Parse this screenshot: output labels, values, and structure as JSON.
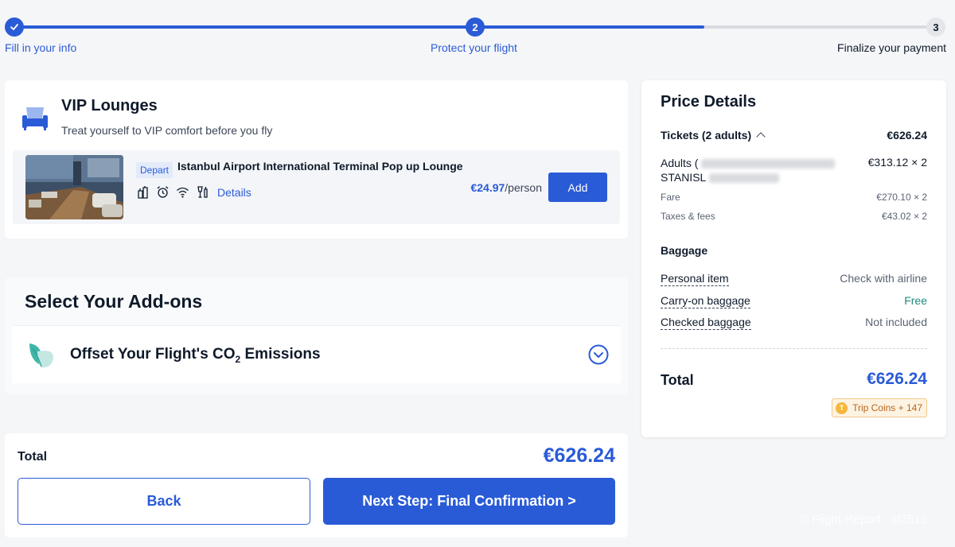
{
  "stepper": {
    "steps": [
      {
        "number": "",
        "label": "Fill in your info",
        "state": "done"
      },
      {
        "number": "2",
        "label": "Protect your flight",
        "state": "active"
      },
      {
        "number": "3",
        "label": "Finalize your payment",
        "state": "todo"
      }
    ],
    "progress_fraction": 0.75
  },
  "vip": {
    "title": "VIP Lounges",
    "subtitle": "Treat yourself to VIP comfort before you fly",
    "lounge": {
      "tag": "Depart",
      "name": "Istanbul Airport International Terminal Pop up Lounge",
      "amenities": [
        "food-icon",
        "alarm-icon",
        "wifi-icon",
        "drinks-icon"
      ],
      "details_label": "Details",
      "price": "€24.97",
      "price_unit": "/person",
      "add_label": "Add"
    }
  },
  "addons": {
    "title": "Select Your Add-ons",
    "offset_label_prefix": "Offset Your Flight's CO",
    "offset_label_sub": "2",
    "offset_label_suffix": " Emissions"
  },
  "footer": {
    "total_label": "Total",
    "total_amount": "€626.24",
    "back_label": "Back",
    "next_label": "Next Step: Final Confirmation >"
  },
  "price_details": {
    "title": "Price Details",
    "tickets_label": "Tickets (2 adults)",
    "tickets_amount": "€626.24",
    "adults_label_line1": "Adults (",
    "adults_label_line2": "STANISL",
    "adults_amount": "€313.12 × 2",
    "fare_label": "Fare",
    "fare_amount": "€270.10 × 2",
    "taxes_label": "Taxes & fees",
    "taxes_amount": "€43.02 × 2",
    "baggage_title": "Baggage",
    "baggage": [
      {
        "name": "Personal item",
        "value": "Check with airline"
      },
      {
        "name": "Carry-on baggage",
        "value": "Free"
      },
      {
        "name": "Checked baggage",
        "value": "Not included"
      }
    ],
    "total_label": "Total",
    "total_amount": "€626.24",
    "coins_label": "Trip Coins + 147"
  },
  "watermark": "© Flight-Report - st7515",
  "colors": {
    "accent": "#2a5bd7",
    "free": "#1f8a7a",
    "coins": "#b8651b"
  }
}
